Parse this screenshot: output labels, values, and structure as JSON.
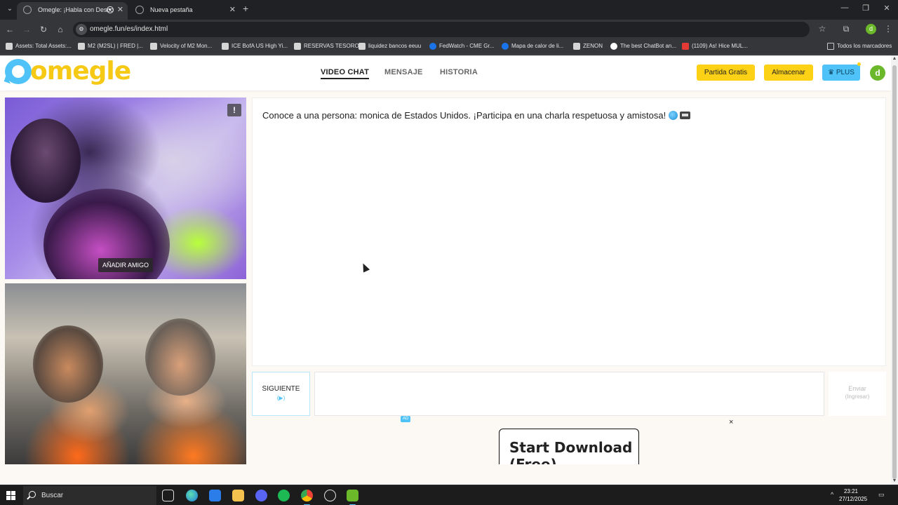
{
  "browser": {
    "tabs": [
      {
        "title": "Omegle: ¡Habla con Desco",
        "active": true
      },
      {
        "title": "Nueva pestaña",
        "active": false
      }
    ],
    "url": "omegle.fun/es/index.html",
    "profile_initial": "d",
    "bookmarks": [
      "Assets: Total Assets:...",
      "M2 (M2SL) | FRED |...",
      "Velocity of M2 Mon...",
      "ICE BofA US High Yi...",
      "RESERVAS TESORO",
      "liquidez bancos eeuu",
      "FedWatch - CME Gr...",
      "Mapa de calor de li...",
      "ZENON",
      "The best ChatBot an...",
      "(1109) As! Hice MUL..."
    ],
    "all_bookmarks": "Todos los marcadores"
  },
  "site": {
    "logo": "omegle",
    "nav": [
      "VIDEO CHAT",
      "MENSAJE",
      "HISTORIA"
    ],
    "header_buttons": {
      "free_game": "Partida Gratis",
      "store": "Almacenar",
      "plus": "PLUS"
    },
    "user_initial": "d"
  },
  "video": {
    "report": "!",
    "add_friend": "AÑADIR AMIGO"
  },
  "chat": {
    "system_message": "Conoce a una persona: monica de Estados Unidos. ¡Participa en una charla respetuosa y amistosa!",
    "next_label": "SIGUIENTE",
    "next_hint": "(▶)",
    "input_value": "",
    "send_label": "Enviar",
    "send_hint": "(Ingresar)"
  },
  "ad": {
    "badge": "AD",
    "close": "×",
    "headline": "Start Download (Free)"
  },
  "taskbar": {
    "search": "Buscar",
    "time": "23:21",
    "date": "27/12/2025"
  },
  "colors": {
    "brand_yellow": "#fcd116",
    "brand_blue": "#4fc3f7",
    "page_background": "#fcf8f3"
  }
}
